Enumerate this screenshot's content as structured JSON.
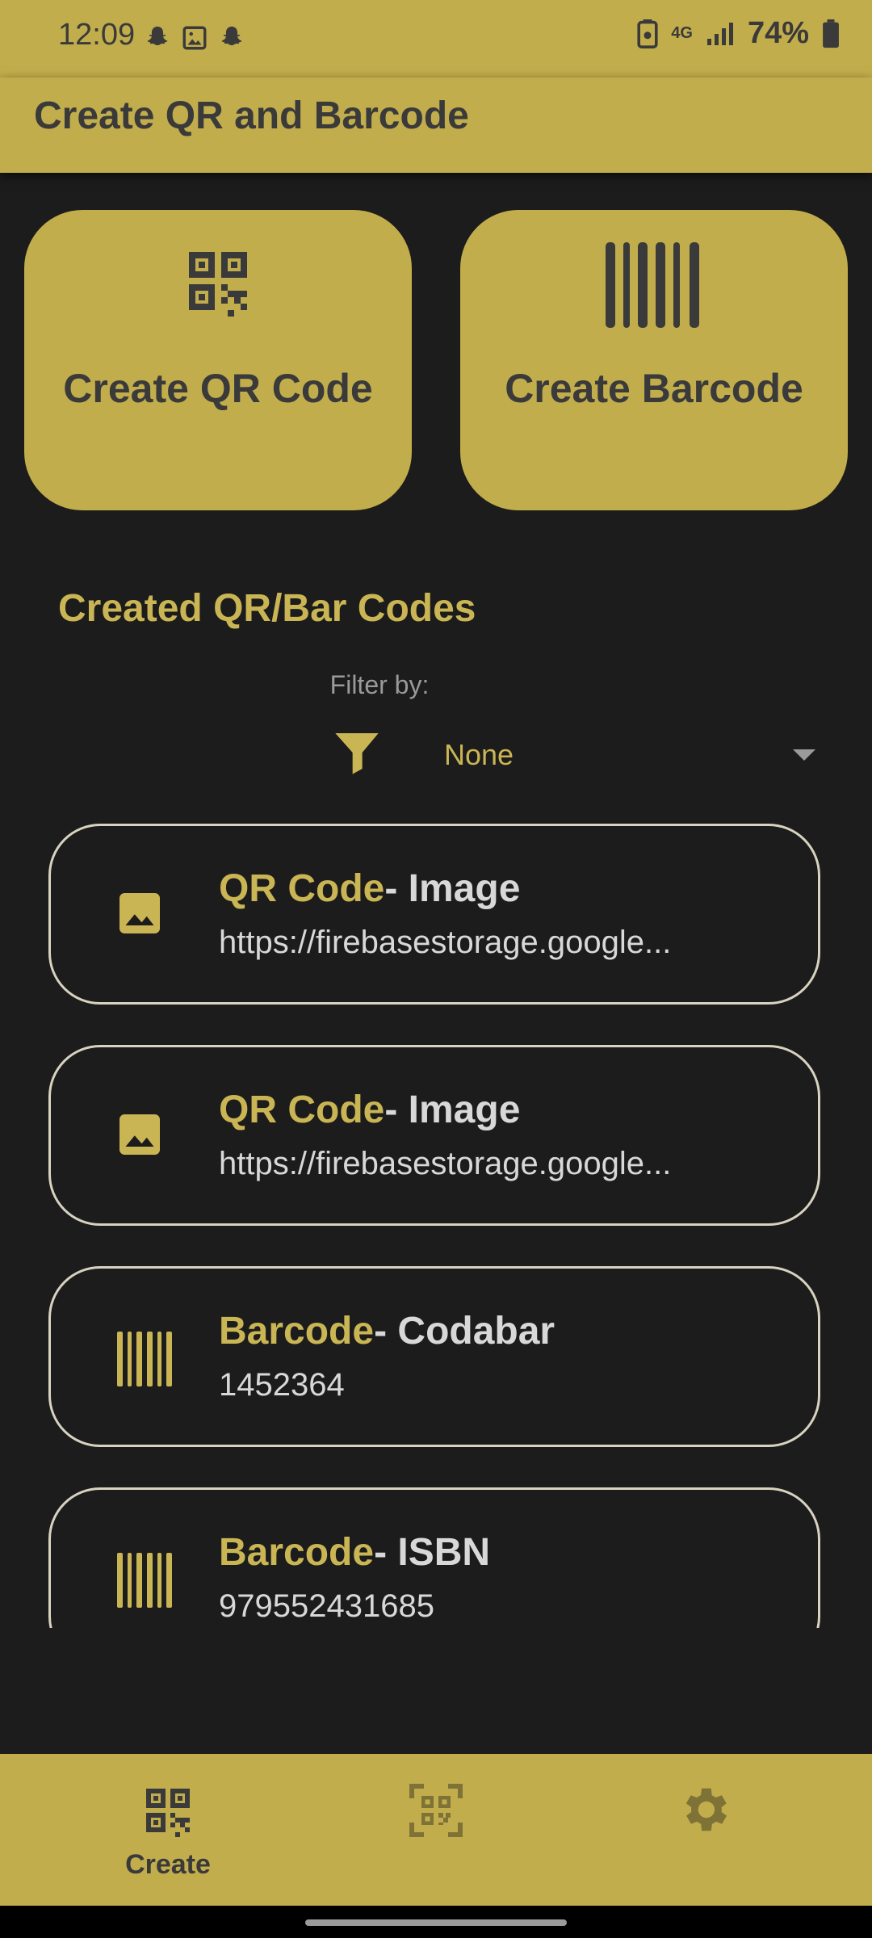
{
  "status_bar": {
    "time": "12:09",
    "battery": "74%",
    "network": "4G"
  },
  "app_bar": {
    "title": "Create QR and Barcode"
  },
  "actions": {
    "create_qr": "Create QR Code",
    "create_barcode": "Create Barcode"
  },
  "section": {
    "title": "Created QR/Bar Codes",
    "filter_label": "Filter by:",
    "filter_value": "None"
  },
  "codes": [
    {
      "kind": "QR Code",
      "subtype": "- Image",
      "content": "https://firebasestorage.google...",
      "icon": "image-icon"
    },
    {
      "kind": "QR Code",
      "subtype": "- Image",
      "content": "https://firebasestorage.google...",
      "icon": "image-icon"
    },
    {
      "kind": "Barcode",
      "subtype": "- Codabar",
      "content": "1452364",
      "icon": "barcode-icon"
    },
    {
      "kind": "Barcode",
      "subtype": "- ISBN",
      "content": "979552431685",
      "icon": "barcode-icon"
    }
  ],
  "bottom_nav": {
    "create_label": "Create"
  },
  "colors": {
    "accent": "#c2ad4c",
    "accent_text": "#c9b554",
    "background": "#1c1c1c",
    "dark_text": "#3a3a3a"
  }
}
